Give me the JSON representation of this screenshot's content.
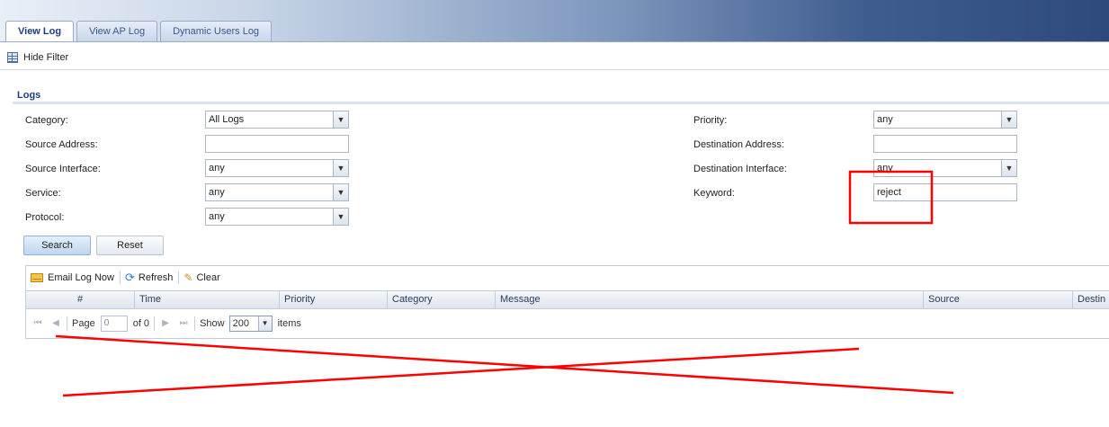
{
  "tabs": [
    {
      "label": "View Log",
      "active": true
    },
    {
      "label": "View AP Log",
      "active": false
    },
    {
      "label": "Dynamic Users Log",
      "active": false
    }
  ],
  "hide_filter_label": "Hide Filter",
  "section_title": "Logs",
  "filters": {
    "category": {
      "label": "Category:",
      "value": "All Logs"
    },
    "source_address": {
      "label": "Source Address:",
      "value": ""
    },
    "source_interface": {
      "label": "Source Interface:",
      "value": "any"
    },
    "service": {
      "label": "Service:",
      "value": "any"
    },
    "protocol": {
      "label": "Protocol:",
      "value": "any"
    },
    "priority": {
      "label": "Priority:",
      "value": "any"
    },
    "destination_address": {
      "label": "Destination Address:",
      "value": ""
    },
    "destination_interface": {
      "label": "Destination Interface:",
      "value": "any"
    },
    "keyword": {
      "label": "Keyword:",
      "value": "reject"
    }
  },
  "buttons": {
    "search": "Search",
    "reset": "Reset"
  },
  "toolbar": {
    "email": "Email Log Now",
    "refresh": "Refresh",
    "clear": "Clear"
  },
  "columns": [
    "#",
    "Time",
    "Priority",
    "Category",
    "Message",
    "Source",
    "Destin"
  ],
  "pager": {
    "page_label": "Page",
    "page_value": "0",
    "of_label": "of 0",
    "show_label": "Show",
    "show_value": "200",
    "items_label": "items"
  },
  "icons": {
    "hide_filter": "table-icon",
    "email": "mail-icon",
    "refresh": "refresh-icon",
    "clear": "broom-icon"
  },
  "colors": {
    "annotation": "#ff0000",
    "accent": "#1d3f78"
  }
}
